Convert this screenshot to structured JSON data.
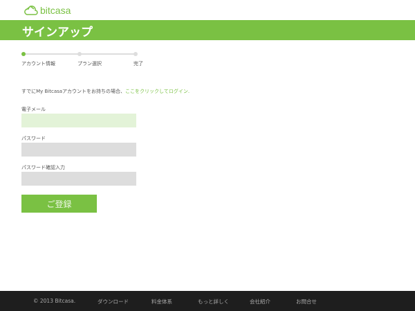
{
  "brand": {
    "name": "bitcasa",
    "accent": "#7ac143"
  },
  "header": {
    "title": "サインアップ"
  },
  "steps": [
    {
      "label": "アカウント情報",
      "active": true
    },
    {
      "label": "プラン選択",
      "active": false
    },
    {
      "label": "完了",
      "active": false
    }
  ],
  "intro": {
    "text": "すでにMy Bitcasaアカウントをお持ちの場合、",
    "link": "ここをクリックしてログイン."
  },
  "form": {
    "email_label": "電子メール",
    "email_value": "",
    "password_label": "パスワード",
    "password_value": "",
    "confirm_label": "パスワード確認入力",
    "confirm_value": "",
    "submit_label": "ご登録"
  },
  "footer": {
    "copyright": "© 2013 Bitcasa.",
    "links": [
      "ダウンロード",
      "料金体系",
      "もっと詳しく",
      "会社紹介",
      "お問合せ"
    ]
  }
}
